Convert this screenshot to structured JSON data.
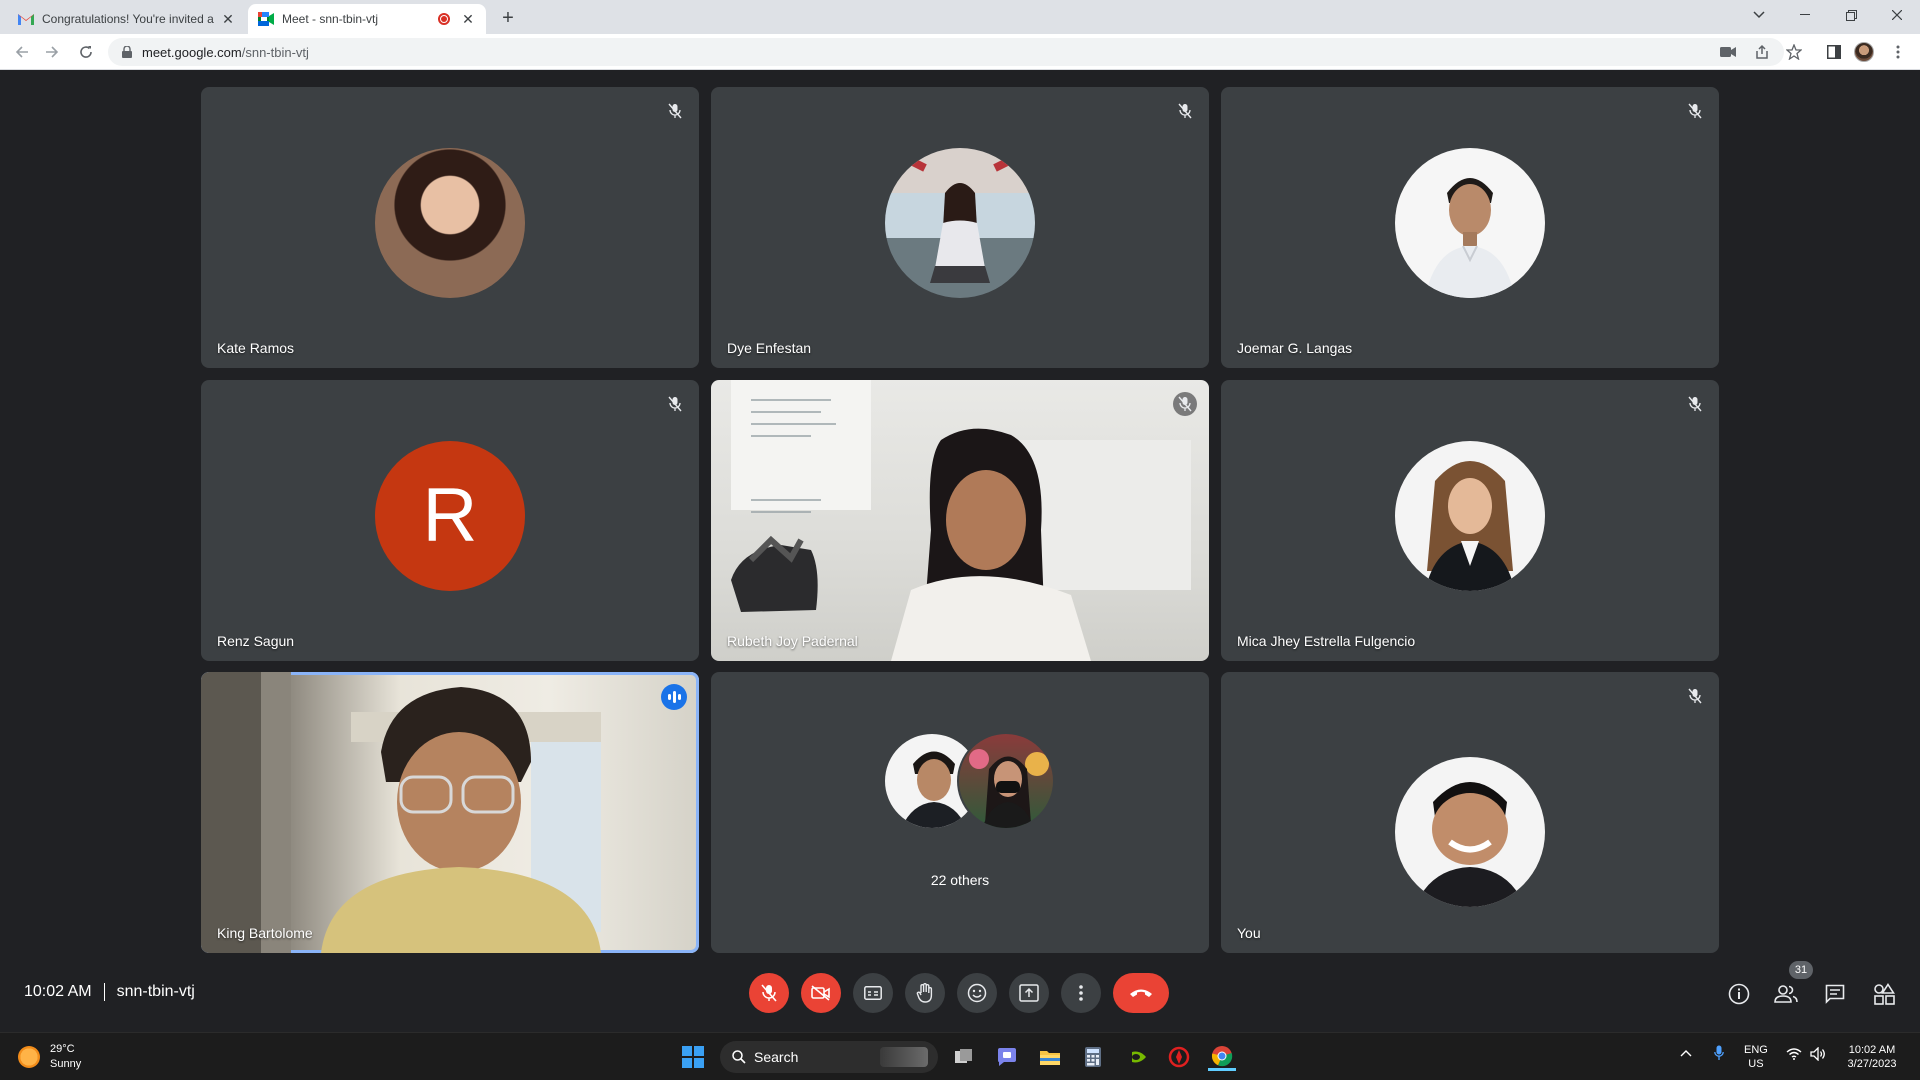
{
  "browser": {
    "tabs": [
      {
        "title": "Congratulations! You're invited a",
        "favicon": "gmail-icon",
        "active": false
      },
      {
        "title": "Meet - snn-tbin-vtj",
        "favicon": "google-meet-icon",
        "active": true,
        "recording": true
      }
    ],
    "url_host": "meet.google.com",
    "url_path": "/snn-tbin-vtj"
  },
  "tiles": [
    {
      "name": "Kate Ramos",
      "muted": true,
      "type": "avatar",
      "avatar_color": "#7a4a3a"
    },
    {
      "name": "Dye Enfestan",
      "muted": true,
      "type": "avatar",
      "avatar_color": "#c9b8b0"
    },
    {
      "name": "Joemar G. Langas",
      "muted": true,
      "type": "avatar",
      "avatar_color": "#f4f4f4"
    },
    {
      "name": "Renz Sagun",
      "muted": true,
      "type": "initial",
      "initial": "R",
      "avatar_color": "#c53711"
    },
    {
      "name": "Rubeth Joy Padernal",
      "muted": true,
      "type": "video"
    },
    {
      "name": "Mica Jhey Estrella Fulgencio",
      "muted": true,
      "type": "avatar",
      "avatar_color": "#2a2420"
    },
    {
      "name": "King Bartolome",
      "muted": false,
      "type": "video",
      "speaking": true
    },
    {
      "name": "",
      "type": "others",
      "others_label": "22 others"
    },
    {
      "name": "You",
      "muted": true,
      "type": "avatar",
      "avatar_color": "#f2f2f2"
    }
  ],
  "meeting": {
    "time": "10:02 AM",
    "code": "snn-tbin-vtj",
    "participant_count": "31"
  },
  "controls": {
    "left_center": [
      "microphone-off-icon",
      "camera-off-icon",
      "captions-icon",
      "raise-hand-icon",
      "emoji-icon",
      "present-screen-icon",
      "more-options-icon",
      "leave-call-icon"
    ],
    "right": [
      "meeting-details-icon",
      "people-icon",
      "chat-icon",
      "activities-icon"
    ]
  },
  "taskbar": {
    "weather_temp": "29°C",
    "weather_desc": "Sunny",
    "search_label": "Search",
    "lang_top": "ENG",
    "lang_bottom": "US",
    "time": "10:02 AM",
    "date": "3/27/2023"
  },
  "colors": {
    "meet_bg": "#202124",
    "tile_bg": "#3c4043",
    "danger": "#ea4335",
    "speaking_outline": "#8ab4f8"
  }
}
